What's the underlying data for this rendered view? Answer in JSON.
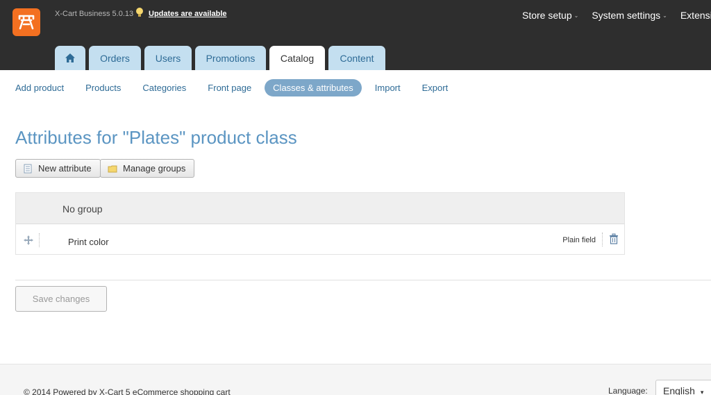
{
  "header": {
    "version": "X-Cart Business 5.0.13",
    "updates_link": "Updates are available",
    "topnav": [
      {
        "label": "Store setup"
      },
      {
        "label": "System settings"
      },
      {
        "label": "Extensions"
      }
    ],
    "tabs": [
      {
        "label": "Orders"
      },
      {
        "label": "Users"
      },
      {
        "label": "Promotions"
      },
      {
        "label": "Catalog"
      },
      {
        "label": "Content"
      }
    ],
    "active_tab": "Catalog"
  },
  "subnav": [
    {
      "label": "Add product"
    },
    {
      "label": "Products"
    },
    {
      "label": "Categories"
    },
    {
      "label": "Front page"
    },
    {
      "label": "Classes & attributes"
    },
    {
      "label": "Import"
    },
    {
      "label": "Export"
    }
  ],
  "active_subnav": "Classes & attributes",
  "page": {
    "title": "Attributes for \"Plates\" product class",
    "new_attribute": "New attribute",
    "manage_groups": "Manage groups",
    "save_changes": "Save changes"
  },
  "table": {
    "group": "No group",
    "rows": [
      {
        "name": "Print color",
        "type": "Plain field"
      }
    ]
  },
  "footer": {
    "copyright": "© 2014 Powered by X-Cart 5 eCommerce shopping cart",
    "language_label": "Language:",
    "language_value": "English"
  },
  "colors": {
    "header_bg": "#2e2e2e",
    "logo": "#f37021",
    "tab_bg": "#c4dff0",
    "title": "#5b95c2",
    "active_pill": "#7da7c9"
  }
}
